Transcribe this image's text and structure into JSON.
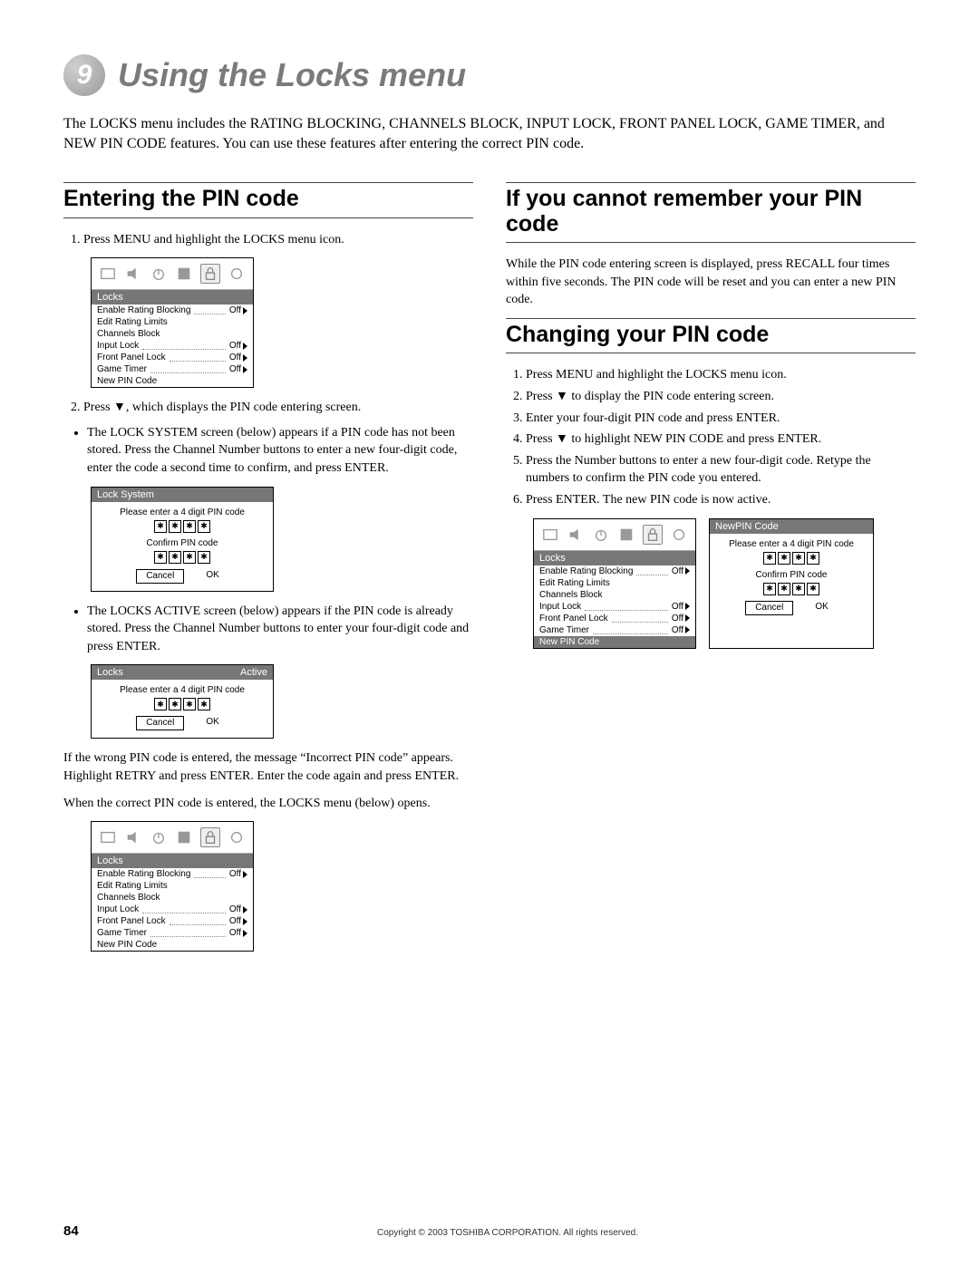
{
  "chapter": {
    "number": "9",
    "title": "Using the Locks menu"
  },
  "intro": "The LOCKS menu includes the RATING BLOCKING, CHANNELS BLOCK, INPUT LOCK, FRONT PANEL LOCK, GAME TIMER, and NEW PIN CODE features. You can use these features after entering the correct PIN code.",
  "left": {
    "section_title": "Entering the PIN code",
    "step1": "Press MENU and highlight the LOCKS menu icon.",
    "step2": "Press ▼, which displays the PIN code entering screen.",
    "bullet1": "The LOCK SYSTEM screen (below) appears if a PIN code has not been stored. Press the Channel Number buttons to enter a new four-digit code, enter the code a second time to confirm, and press ENTER.",
    "bullet2": "The LOCKS ACTIVE screen (below) appears if the PIN code is already stored. Press the Channel Number buttons to enter your four-digit code and press ENTER.",
    "wrong": "If the wrong PIN code is entered, the message “Incorrect PIN code” appears. Highlight RETRY and press ENTER. Enter the code again and press ENTER.",
    "correct": "When the correct PIN code is entered, the LOCKS menu (below) opens."
  },
  "right": {
    "section1_title": "If you cannot remember your PIN code",
    "section1_body": "While the PIN code entering screen is displayed, press RECALL four times within five seconds. The PIN code will be reset and you can enter a new PIN code.",
    "section2_title": "Changing your PIN code",
    "steps": [
      "Press MENU and highlight the LOCKS menu icon.",
      "Press ▼ to display the PIN code entering screen.",
      "Enter your four-digit PIN code and press ENTER.",
      "Press ▼ to highlight NEW PIN CODE and press ENTER.",
      "Press the Number buttons to enter a new four-digit code. Retype the numbers to confirm the PIN code you entered.",
      "Press ENTER. The new PIN code is now active."
    ]
  },
  "menu": {
    "title": "Locks",
    "items": [
      {
        "label": "Enable Rating Blocking",
        "value": "Off",
        "arrow": true
      },
      {
        "label": "Edit Rating Limits",
        "value": "",
        "arrow": false
      },
      {
        "label": "Channels Block",
        "value": "",
        "arrow": false
      },
      {
        "label": "Input Lock",
        "value": "Off",
        "arrow": true
      },
      {
        "label": "Front Panel Lock",
        "value": "Off",
        "arrow": true
      },
      {
        "label": "Game Timer",
        "value": "Off",
        "arrow": true
      },
      {
        "label": "New PIN Code",
        "value": "",
        "arrow": false
      }
    ]
  },
  "lock_system": {
    "title": "Lock System",
    "line1": "Please enter a 4 digit PIN code",
    "line2": "Confirm PIN code",
    "cancel": "Cancel",
    "ok": "OK"
  },
  "locks_active": {
    "title": "Locks",
    "status": "Active",
    "line1": "Please enter a 4 digit PIN code",
    "cancel": "Cancel",
    "ok": "OK"
  },
  "newpin": {
    "title": "NewPIN Code",
    "line1": "Please enter a 4 digit PIN code",
    "line2": "Confirm PIN code",
    "cancel": "Cancel",
    "ok": "OK"
  },
  "star": "✱",
  "footer": {
    "page": "84",
    "copyright": "Copyright © 2003 TOSHIBA CORPORATION. All rights reserved."
  }
}
